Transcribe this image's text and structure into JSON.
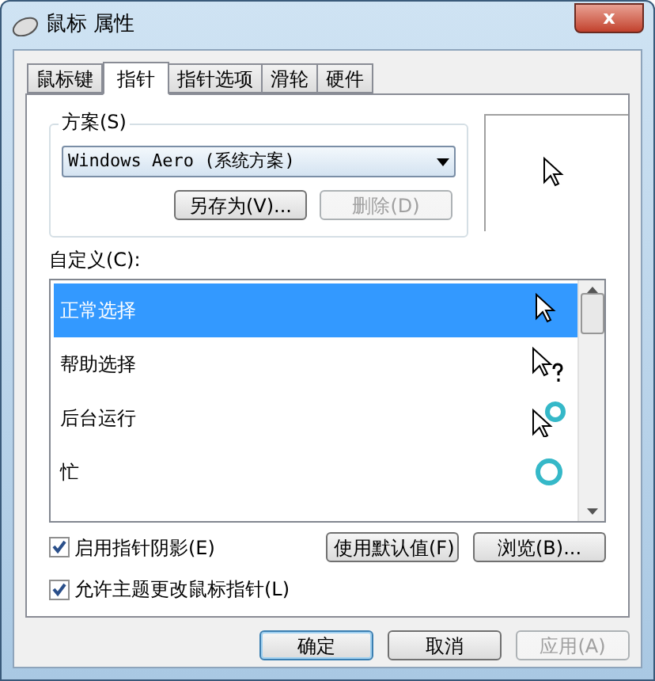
{
  "window": {
    "title": "鼠标 属性",
    "close": "x"
  },
  "tabs": [
    {
      "label": "鼠标键",
      "selected": false
    },
    {
      "label": "指针",
      "selected": true
    },
    {
      "label": "指针选项",
      "selected": false
    },
    {
      "label": "滑轮",
      "selected": false
    },
    {
      "label": "硬件",
      "selected": false
    }
  ],
  "scheme": {
    "label": "方案(S)",
    "value": "Windows Aero (系统方案)",
    "buttons": [
      {
        "label": "另存为(V)...",
        "disabled": false
      },
      {
        "label": "删除(D)",
        "disabled": true
      }
    ]
  },
  "customize": {
    "label": "自定义(C):",
    "items": [
      {
        "label": "正常选择",
        "kind": "normal",
        "selected": true
      },
      {
        "label": "帮助选择",
        "kind": "help",
        "selected": false
      },
      {
        "label": "后台运行",
        "kind": "working",
        "selected": false
      },
      {
        "label": "忙",
        "kind": "busy",
        "selected": false
      }
    ]
  },
  "options": [
    {
      "label": "启用指针阴影(E)",
      "checked": true
    },
    {
      "label": "允许主题更改鼠标指针(L)",
      "checked": true
    }
  ],
  "list_buttons": [
    "使用默认值(F)",
    "浏览(B)..."
  ],
  "footer": [
    {
      "label": "确定",
      "disabled": false,
      "default": true
    },
    {
      "label": "取消",
      "disabled": false,
      "default": false
    },
    {
      "label": "应用(A)",
      "disabled": true,
      "default": false
    }
  ]
}
